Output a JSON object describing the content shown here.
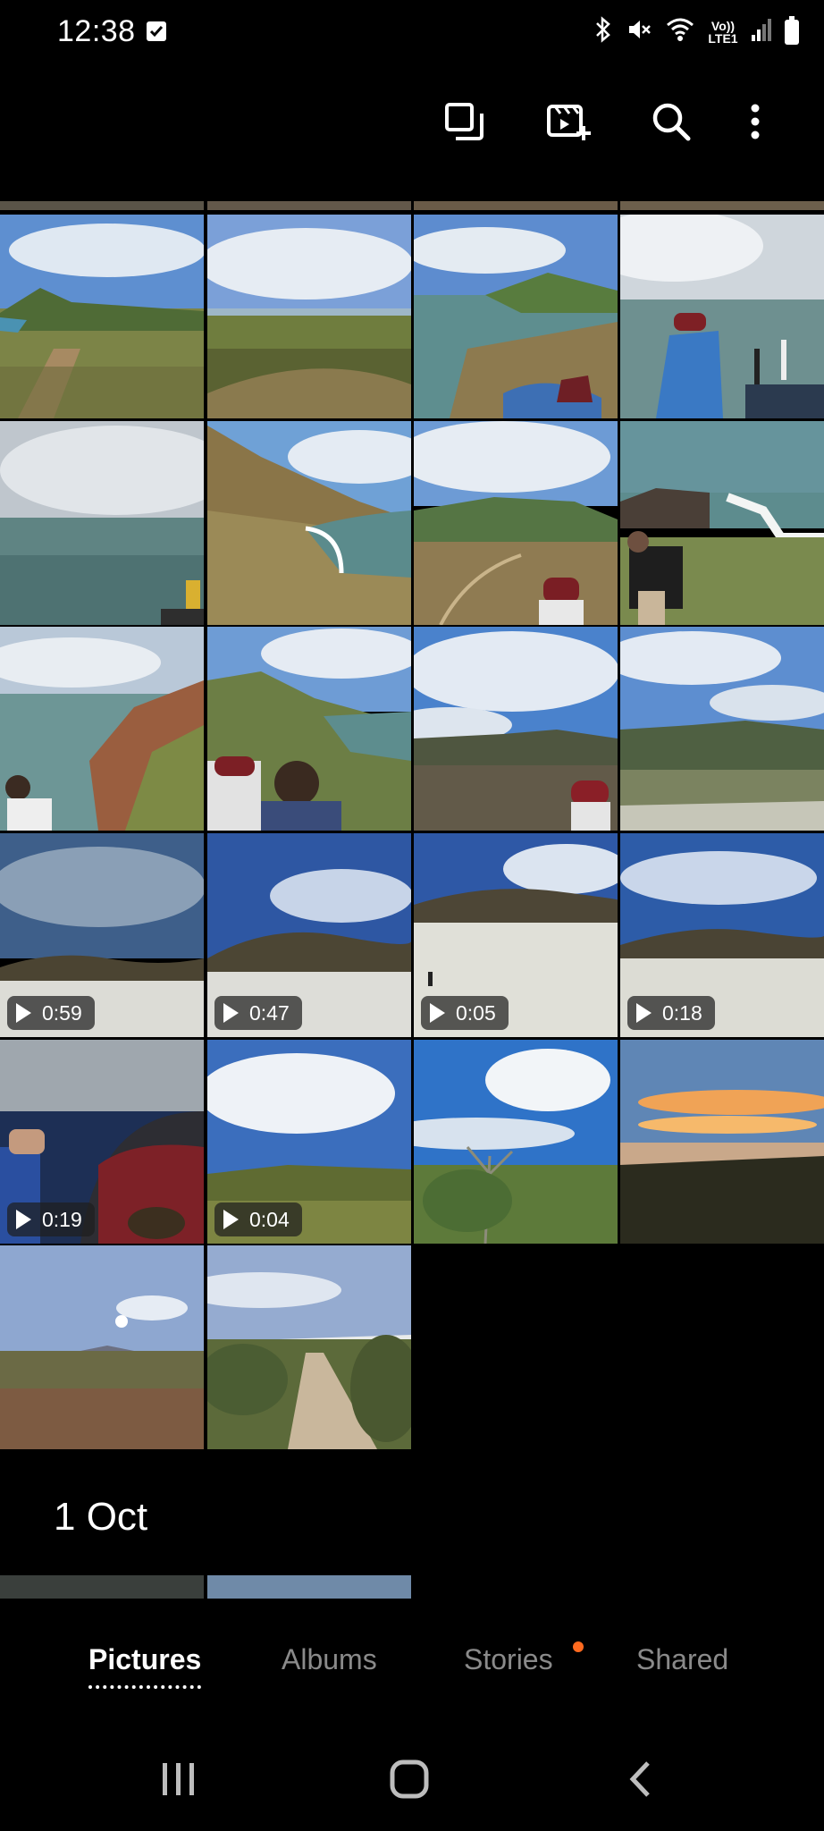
{
  "status_bar": {
    "time": "12:38",
    "network": "Vo)) LTE1"
  },
  "toolbar": {
    "icons": [
      "select-icon",
      "create-video-icon",
      "search-icon",
      "more-options-icon"
    ]
  },
  "grid": {
    "tiles": [
      {
        "scene": "coast-hill",
        "duration": ""
      },
      {
        "scene": "grassland",
        "duration": ""
      },
      {
        "scene": "headland-person",
        "duration": ""
      },
      {
        "scene": "ocean-man-back",
        "duration": ""
      },
      {
        "scene": "ocean-grey",
        "duration": ""
      },
      {
        "scene": "cliff-bay",
        "duration": ""
      },
      {
        "scene": "plateau-cap",
        "duration": ""
      },
      {
        "scene": "rocks-waves-man",
        "duration": ""
      },
      {
        "scene": "cliff-person",
        "duration": ""
      },
      {
        "scene": "two-heads-headland",
        "duration": ""
      },
      {
        "scene": "scrub-cap",
        "duration": ""
      },
      {
        "scene": "scrub-hills",
        "duration": ""
      },
      {
        "scene": "dune-dark-sky",
        "duration": "0:59"
      },
      {
        "scene": "dune-blue",
        "duration": "0:47"
      },
      {
        "scene": "dune-walker",
        "duration": "0:05"
      },
      {
        "scene": "dune-wide",
        "duration": "0:18"
      },
      {
        "scene": "truck-cap",
        "duration": "0:19"
      },
      {
        "scene": "green-clouds",
        "duration": "0:04"
      },
      {
        "scene": "tree-clouds",
        "duration": ""
      },
      {
        "scene": "sunset",
        "duration": ""
      },
      {
        "scene": "moon-scrub",
        "duration": ""
      },
      {
        "scene": "dirt-road",
        "duration": ""
      }
    ]
  },
  "section": {
    "date": "1 Oct"
  },
  "bottom_nav": {
    "tabs": [
      {
        "label": "Pictures",
        "active": true
      },
      {
        "label": "Albums",
        "active": false
      },
      {
        "label": "Stories",
        "active": false,
        "badge": true
      },
      {
        "label": "Shared",
        "active": false
      }
    ]
  },
  "colors": {
    "background": "#000000",
    "badge": "#ff6a1f",
    "inactive_tab": "#8a8a8a"
  }
}
